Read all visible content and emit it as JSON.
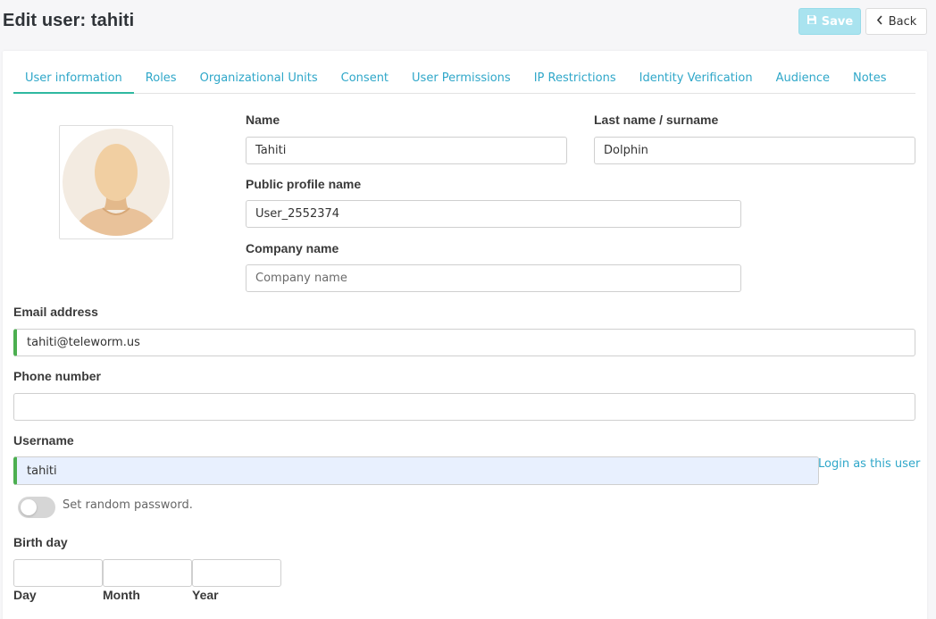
{
  "header": {
    "title": "Edit user: tahiti",
    "save_label": "Save",
    "back_label": "Back"
  },
  "tabs": [
    {
      "label": "User information",
      "active": true
    },
    {
      "label": "Roles"
    },
    {
      "label": "Organizational Units"
    },
    {
      "label": "Consent"
    },
    {
      "label": "User Permissions"
    },
    {
      "label": "IP Restrictions"
    },
    {
      "label": "Identity Verification"
    },
    {
      "label": "Audience"
    },
    {
      "label": "Notes"
    }
  ],
  "form": {
    "name": {
      "label": "Name",
      "value": "Tahiti"
    },
    "surname": {
      "label": "Last name / surname",
      "value": "Dolphin"
    },
    "public_name": {
      "label": "Public profile name",
      "value": "User_2552374"
    },
    "company": {
      "label": "Company name",
      "placeholder": "Company name"
    },
    "email": {
      "label": "Email address",
      "value": "tahiti@teleworm.us"
    },
    "phone": {
      "label": "Phone number",
      "value": ""
    },
    "username": {
      "label": "Username",
      "value": "tahiti",
      "login_link": "Login as this user"
    },
    "random_password": {
      "label": "Set random password.",
      "enabled": false
    },
    "birthday": {
      "label": "Birth day",
      "day_label": "Day",
      "month_label": "Month",
      "year_label": "Year"
    }
  },
  "colors": {
    "accent": "#2fa7c9",
    "tab_underline": "#2fb8a0",
    "valid_bar": "#4caf50",
    "save_disabled": "#a9e3ef"
  },
  "icons": {
    "save": "floppy-disk-icon",
    "back": "chevron-left-icon",
    "avatar": "default-user-avatar"
  }
}
